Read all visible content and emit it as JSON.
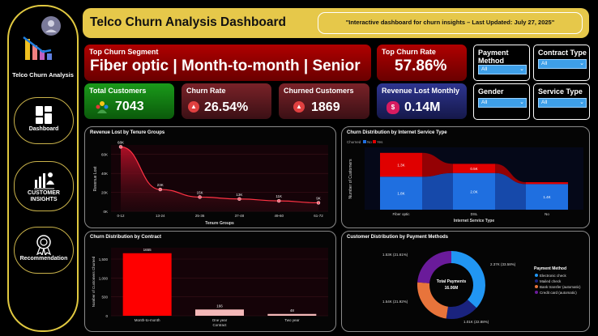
{
  "sidebar": {
    "app_title": "Telco Churn Analysis",
    "nav": [
      {
        "label": "Dashboard"
      },
      {
        "label": "CUSTOMER INSIGHTS"
      },
      {
        "label": "Recommendation"
      }
    ]
  },
  "header": {
    "title": "Telco Churn Analysis Dashboard",
    "subtitle": "\"Interactive dashboard for churn insights – Last Updated: July 27, 2025\""
  },
  "kpis": {
    "top_segment": {
      "label": "Top Churn Segment",
      "value": "Fiber optic | Month-to-month | Senior"
    },
    "top_rate": {
      "label": "Top Churn Rate",
      "value": "57.86%"
    },
    "total_customers": {
      "label": "Total Customers",
      "value": "7043"
    },
    "churn_rate": {
      "label": "Churn Rate",
      "value": "26.54%"
    },
    "churned": {
      "label": "Churned Customers",
      "value": "1869"
    },
    "revenue_lost": {
      "label": "Revenue Lost Monthly",
      "value": "0.14M",
      "icon": "dollar-icon"
    }
  },
  "filters": [
    {
      "label": "Payment Method",
      "value": "All"
    },
    {
      "label": "Contract Type",
      "value": "All"
    },
    {
      "label": "Gender",
      "value": "All"
    },
    {
      "label": "Service Type",
      "value": "All"
    }
  ],
  "colors": {
    "gold": "#e6c84a",
    "red": "#cc0000",
    "blue": "#1f6fe0",
    "green": "#1a8a1a",
    "navy": "#2a2f7a"
  },
  "chart_data": [
    {
      "type": "area",
      "title": "Revenue Lost by Tenure Groups",
      "xlabel": "Tenure Groups",
      "ylabel": "Revenue Lost",
      "categories": [
        "0-12",
        "13-24",
        "25-36",
        "37-48",
        "49-60",
        "61-72"
      ],
      "values": [
        68000,
        23000,
        15000,
        13000,
        11000,
        9000
      ],
      "data_labels": [
        "68K",
        "23K",
        "15K",
        "13K",
        "11K",
        "9K"
      ],
      "yticks": [
        "0K",
        "20K",
        "40K",
        "60K"
      ],
      "ylim": [
        0,
        70000
      ]
    },
    {
      "type": "bar",
      "title": "Churn Distribution by Internet Service Type",
      "xlabel": "Internet Service Type",
      "ylabel": "Number of Customers",
      "legend_title": "Churned",
      "legend": [
        "No",
        "Yes"
      ],
      "categories": [
        "Fiber optic",
        "DSL",
        "No"
      ],
      "series": [
        {
          "name": "No",
          "values": [
            1800,
            2000,
            1400
          ],
          "labels": [
            "1.8K",
            "2.0K",
            "1.4K"
          ]
        },
        {
          "name": "Yes",
          "values": [
            1300,
            500,
            100
          ],
          "labels": [
            "1.3K",
            "0.5K",
            ""
          ]
        }
      ]
    },
    {
      "type": "bar",
      "title": "Churn Distribution by Contract",
      "xlabel": "Contract",
      "ylabel": "Number of Customers Churned",
      "categories": [
        "Month-to-month",
        "One year",
        "Two year"
      ],
      "values": [
        1655,
        166,
        48
      ],
      "data_labels": [
        "1655",
        "166",
        "48"
      ],
      "yticks": [
        "0",
        "500",
        "1,000",
        "1,500"
      ],
      "ylim": [
        0,
        1800
      ]
    },
    {
      "type": "pie",
      "title": "Customer Distribution by Payment Methods",
      "center_label": "Total Payments",
      "center_value": "16.06M",
      "legend_title": "Payment Method",
      "categories": [
        "Electronic check",
        "Mailed check",
        "Bank transfer (automatic)",
        "Credit card (automatic)"
      ],
      "values": [
        2.37,
        1.01,
        1.54,
        1.53
      ],
      "slice_labels": [
        "2.37K (33.58%)",
        "1.01K (22.88%)",
        "1.54K (21.92%)",
        "1.53K (21.61%)"
      ],
      "colors": [
        "#2196f3",
        "#1a237e",
        "#e8743b",
        "#6a1b9a"
      ]
    }
  ]
}
